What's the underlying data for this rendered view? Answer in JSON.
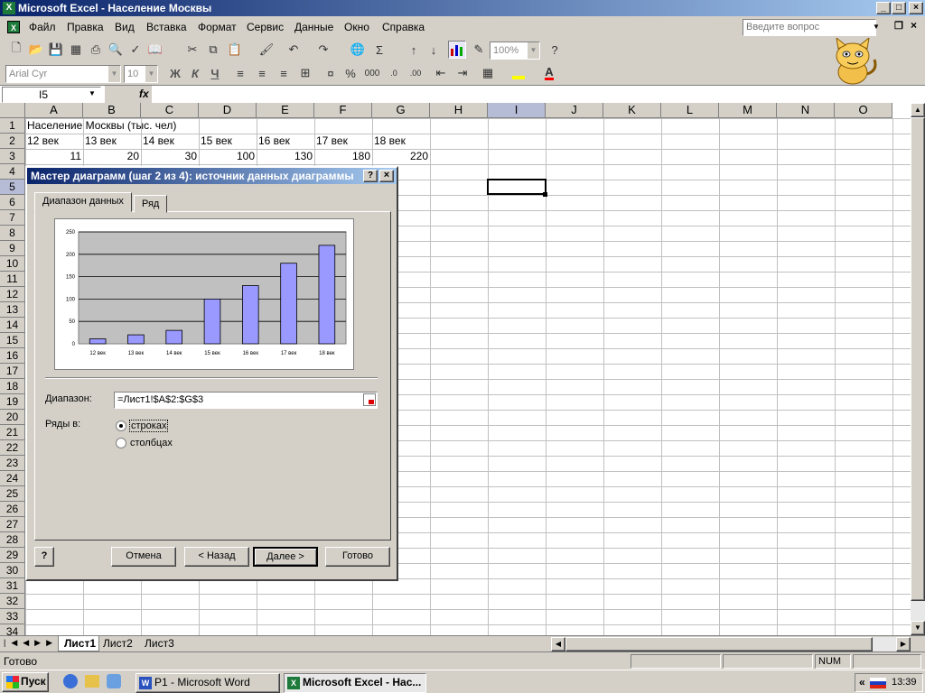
{
  "window": {
    "title": "Microsoft Excel - Население Москвы",
    "min_label": "_",
    "max_label": "□",
    "close_label": "×",
    "help_placeholder": "Введите вопрос"
  },
  "menu": [
    "Файл",
    "Правка",
    "Вид",
    "Вставка",
    "Формат",
    "Сервис",
    "Данные",
    "Окно",
    "Справка"
  ],
  "toolbar": {
    "zoom": "100%",
    "font": "Arial Cyr",
    "size": "10",
    "bold": "Ж",
    "italic": "К",
    "underline": "Ч"
  },
  "formula_bar": {
    "name_box": "I5",
    "fx": "fx",
    "value": ""
  },
  "columns": [
    "A",
    "B",
    "C",
    "D",
    "E",
    "F",
    "G",
    "H",
    "I",
    "J",
    "K",
    "L",
    "M",
    "N",
    "O"
  ],
  "rows": [
    "1",
    "2",
    "3",
    "4",
    "5",
    "6",
    "7",
    "8",
    "9",
    "10",
    "11",
    "12",
    "13",
    "14",
    "15",
    "16",
    "17",
    "18",
    "19",
    "20",
    "21",
    "22",
    "23",
    "24",
    "25",
    "26",
    "27",
    "28",
    "29",
    "30",
    "31",
    "32",
    "33",
    "34"
  ],
  "sheet": {
    "title": "Население Москвы (тыс. чел)",
    "centuries": [
      "12 век",
      "13 век",
      "14 век",
      "15 век",
      "16 век",
      "17 век",
      "18 век"
    ],
    "values": [
      "11",
      "20",
      "30",
      "100",
      "130",
      "180",
      "220"
    ]
  },
  "sheet_tabs": [
    "Лист1",
    "Лист2",
    "Лист3"
  ],
  "dialog": {
    "title": "Мастер диаграмм (шаг 2 из 4): источник данных диаграммы",
    "help_button": "?",
    "close_button": "×",
    "tab_range": "Диапазон данных",
    "tab_series": "Ряд",
    "range_label": "Диапазон:",
    "range_value": "=Лист1!$A$2:$G$3",
    "series_in_label": "Ряды в:",
    "opt_rows": "строках",
    "opt_cols": "столбцах",
    "btn_cancel": "Отмена",
    "btn_back": "< Назад",
    "btn_next": "Далее >",
    "btn_finish": "Готово"
  },
  "chart_data": {
    "type": "bar",
    "categories": [
      "12 век",
      "13 век",
      "14 век",
      "15 век",
      "16 век",
      "17 век",
      "18 век"
    ],
    "values": [
      11,
      20,
      30,
      100,
      130,
      180,
      220
    ],
    "y_ticks": [
      "0",
      "50",
      "100",
      "150",
      "200",
      "250"
    ],
    "ylim": [
      0,
      250
    ],
    "bar_color": "#9999ff",
    "plot_bg": "#c0c0c0",
    "grid": true,
    "legend": "none",
    "title": ""
  },
  "status": {
    "ready": "Готово",
    "num": "NUM"
  },
  "taskbar": {
    "start": "Пуск",
    "task_word": "P1 - Microsoft Word",
    "task_excel": "Microsoft Excel - Нас...",
    "tray_arrows": "«",
    "clock": "13:39"
  }
}
